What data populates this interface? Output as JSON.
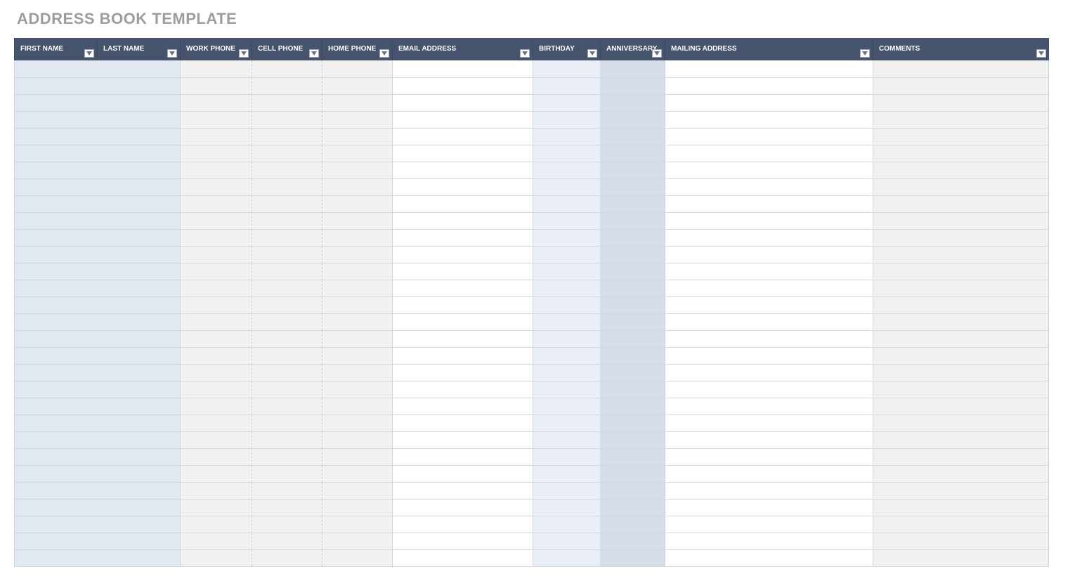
{
  "title": "ADDRESS BOOK TEMPLATE",
  "columns": [
    {
      "key": "first_name",
      "label": "FIRST NAME"
    },
    {
      "key": "last_name",
      "label": "LAST NAME"
    },
    {
      "key": "work_phone",
      "label": "WORK PHONE"
    },
    {
      "key": "cell_phone",
      "label": "CELL PHONE"
    },
    {
      "key": "home_phone",
      "label": "HOME PHONE"
    },
    {
      "key": "email",
      "label": "EMAIL ADDRESS"
    },
    {
      "key": "birthday",
      "label": "BIRTHDAY"
    },
    {
      "key": "anniversary",
      "label": "ANNIVERSARY"
    },
    {
      "key": "mailing",
      "label": "MAILING ADDRESS"
    },
    {
      "key": "comments",
      "label": "COMMENTS"
    }
  ],
  "row_count": 30,
  "rows": [
    {
      "first_name": "",
      "last_name": "",
      "work_phone": "",
      "cell_phone": "",
      "home_phone": "",
      "email": "",
      "birthday": "",
      "anniversary": "",
      "mailing": "",
      "comments": ""
    },
    {
      "first_name": "",
      "last_name": "",
      "work_phone": "",
      "cell_phone": "",
      "home_phone": "",
      "email": "",
      "birthday": "",
      "anniversary": "",
      "mailing": "",
      "comments": ""
    },
    {
      "first_name": "",
      "last_name": "",
      "work_phone": "",
      "cell_phone": "",
      "home_phone": "",
      "email": "",
      "birthday": "",
      "anniversary": "",
      "mailing": "",
      "comments": ""
    },
    {
      "first_name": "",
      "last_name": "",
      "work_phone": "",
      "cell_phone": "",
      "home_phone": "",
      "email": "",
      "birthday": "",
      "anniversary": "",
      "mailing": "",
      "comments": ""
    },
    {
      "first_name": "",
      "last_name": "",
      "work_phone": "",
      "cell_phone": "",
      "home_phone": "",
      "email": "",
      "birthday": "",
      "anniversary": "",
      "mailing": "",
      "comments": ""
    },
    {
      "first_name": "",
      "last_name": "",
      "work_phone": "",
      "cell_phone": "",
      "home_phone": "",
      "email": "",
      "birthday": "",
      "anniversary": "",
      "mailing": "",
      "comments": ""
    },
    {
      "first_name": "",
      "last_name": "",
      "work_phone": "",
      "cell_phone": "",
      "home_phone": "",
      "email": "",
      "birthday": "",
      "anniversary": "",
      "mailing": "",
      "comments": ""
    },
    {
      "first_name": "",
      "last_name": "",
      "work_phone": "",
      "cell_phone": "",
      "home_phone": "",
      "email": "",
      "birthday": "",
      "anniversary": "",
      "mailing": "",
      "comments": ""
    },
    {
      "first_name": "",
      "last_name": "",
      "work_phone": "",
      "cell_phone": "",
      "home_phone": "",
      "email": "",
      "birthday": "",
      "anniversary": "",
      "mailing": "",
      "comments": ""
    },
    {
      "first_name": "",
      "last_name": "",
      "work_phone": "",
      "cell_phone": "",
      "home_phone": "",
      "email": "",
      "birthday": "",
      "anniversary": "",
      "mailing": "",
      "comments": ""
    },
    {
      "first_name": "",
      "last_name": "",
      "work_phone": "",
      "cell_phone": "",
      "home_phone": "",
      "email": "",
      "birthday": "",
      "anniversary": "",
      "mailing": "",
      "comments": ""
    },
    {
      "first_name": "",
      "last_name": "",
      "work_phone": "",
      "cell_phone": "",
      "home_phone": "",
      "email": "",
      "birthday": "",
      "anniversary": "",
      "mailing": "",
      "comments": ""
    },
    {
      "first_name": "",
      "last_name": "",
      "work_phone": "",
      "cell_phone": "",
      "home_phone": "",
      "email": "",
      "birthday": "",
      "anniversary": "",
      "mailing": "",
      "comments": ""
    },
    {
      "first_name": "",
      "last_name": "",
      "work_phone": "",
      "cell_phone": "",
      "home_phone": "",
      "email": "",
      "birthday": "",
      "anniversary": "",
      "mailing": "",
      "comments": ""
    },
    {
      "first_name": "",
      "last_name": "",
      "work_phone": "",
      "cell_phone": "",
      "home_phone": "",
      "email": "",
      "birthday": "",
      "anniversary": "",
      "mailing": "",
      "comments": ""
    },
    {
      "first_name": "",
      "last_name": "",
      "work_phone": "",
      "cell_phone": "",
      "home_phone": "",
      "email": "",
      "birthday": "",
      "anniversary": "",
      "mailing": "",
      "comments": ""
    },
    {
      "first_name": "",
      "last_name": "",
      "work_phone": "",
      "cell_phone": "",
      "home_phone": "",
      "email": "",
      "birthday": "",
      "anniversary": "",
      "mailing": "",
      "comments": ""
    },
    {
      "first_name": "",
      "last_name": "",
      "work_phone": "",
      "cell_phone": "",
      "home_phone": "",
      "email": "",
      "birthday": "",
      "anniversary": "",
      "mailing": "",
      "comments": ""
    },
    {
      "first_name": "",
      "last_name": "",
      "work_phone": "",
      "cell_phone": "",
      "home_phone": "",
      "email": "",
      "birthday": "",
      "anniversary": "",
      "mailing": "",
      "comments": ""
    },
    {
      "first_name": "",
      "last_name": "",
      "work_phone": "",
      "cell_phone": "",
      "home_phone": "",
      "email": "",
      "birthday": "",
      "anniversary": "",
      "mailing": "",
      "comments": ""
    },
    {
      "first_name": "",
      "last_name": "",
      "work_phone": "",
      "cell_phone": "",
      "home_phone": "",
      "email": "",
      "birthday": "",
      "anniversary": "",
      "mailing": "",
      "comments": ""
    },
    {
      "first_name": "",
      "last_name": "",
      "work_phone": "",
      "cell_phone": "",
      "home_phone": "",
      "email": "",
      "birthday": "",
      "anniversary": "",
      "mailing": "",
      "comments": ""
    },
    {
      "first_name": "",
      "last_name": "",
      "work_phone": "",
      "cell_phone": "",
      "home_phone": "",
      "email": "",
      "birthday": "",
      "anniversary": "",
      "mailing": "",
      "comments": ""
    },
    {
      "first_name": "",
      "last_name": "",
      "work_phone": "",
      "cell_phone": "",
      "home_phone": "",
      "email": "",
      "birthday": "",
      "anniversary": "",
      "mailing": "",
      "comments": ""
    },
    {
      "first_name": "",
      "last_name": "",
      "work_phone": "",
      "cell_phone": "",
      "home_phone": "",
      "email": "",
      "birthday": "",
      "anniversary": "",
      "mailing": "",
      "comments": ""
    },
    {
      "first_name": "",
      "last_name": "",
      "work_phone": "",
      "cell_phone": "",
      "home_phone": "",
      "email": "",
      "birthday": "",
      "anniversary": "",
      "mailing": "",
      "comments": ""
    },
    {
      "first_name": "",
      "last_name": "",
      "work_phone": "",
      "cell_phone": "",
      "home_phone": "",
      "email": "",
      "birthday": "",
      "anniversary": "",
      "mailing": "",
      "comments": ""
    },
    {
      "first_name": "",
      "last_name": "",
      "work_phone": "",
      "cell_phone": "",
      "home_phone": "",
      "email": "",
      "birthday": "",
      "anniversary": "",
      "mailing": "",
      "comments": ""
    },
    {
      "first_name": "",
      "last_name": "",
      "work_phone": "",
      "cell_phone": "",
      "home_phone": "",
      "email": "",
      "birthday": "",
      "anniversary": "",
      "mailing": "",
      "comments": ""
    },
    {
      "first_name": "",
      "last_name": "",
      "work_phone": "",
      "cell_phone": "",
      "home_phone": "",
      "email": "",
      "birthday": "",
      "anniversary": "",
      "mailing": "",
      "comments": ""
    }
  ]
}
